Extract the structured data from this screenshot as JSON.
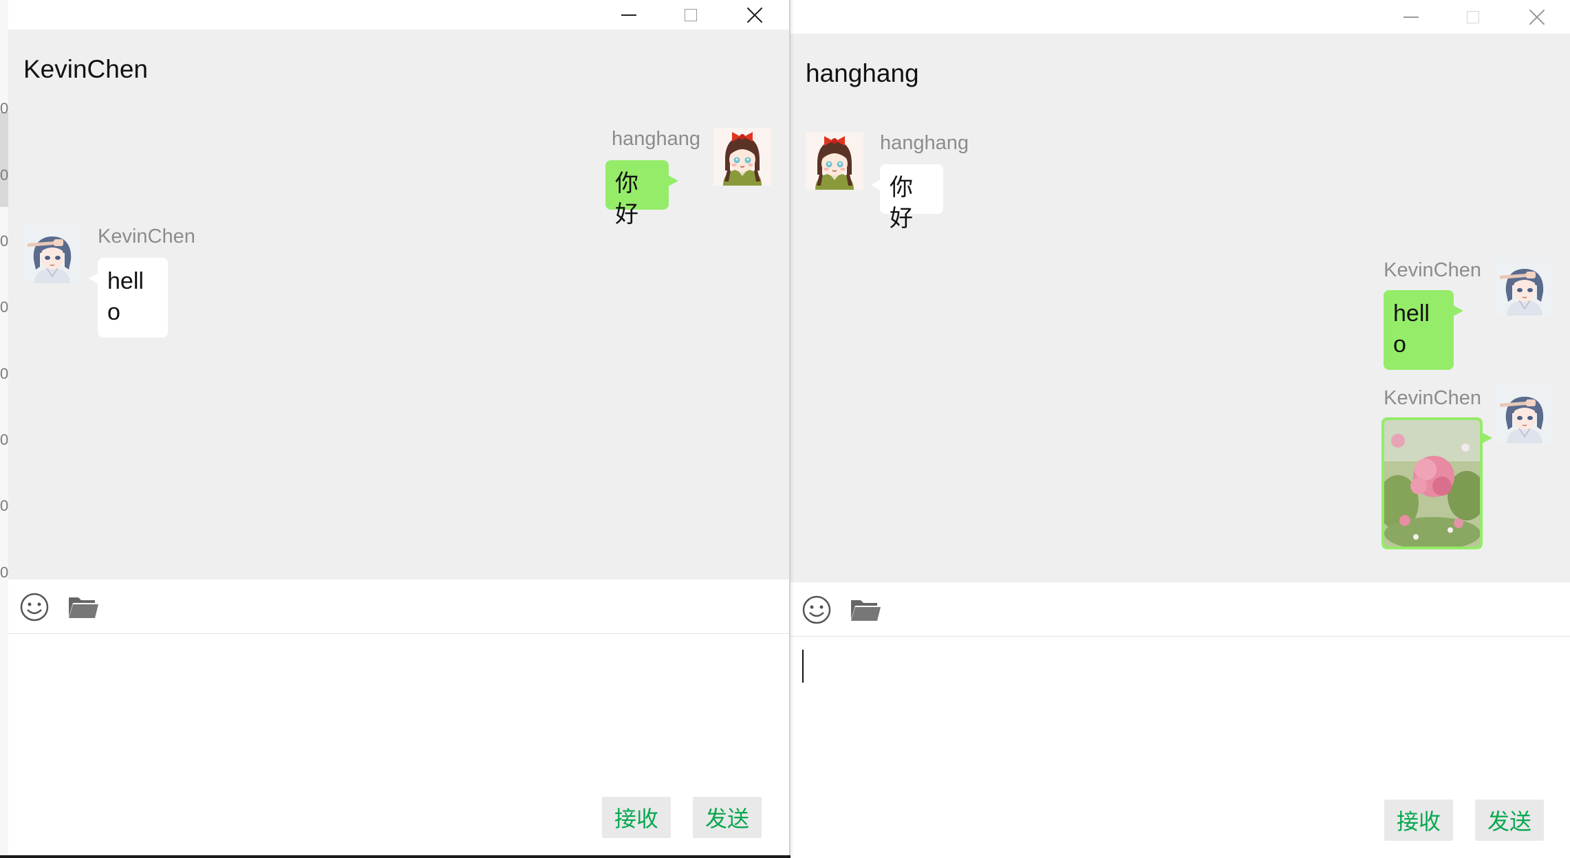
{
  "background": {
    "left_margin_digits": [
      "0",
      "0",
      "0",
      "0",
      "0",
      "0",
      "0",
      "0"
    ]
  },
  "left_window": {
    "title": "KevinChen",
    "messages": [
      {
        "sender": "hanghang",
        "side": "right",
        "text": "你好"
      },
      {
        "sender": "KevinChen",
        "side": "left",
        "text": "hell\no"
      }
    ],
    "buttons": {
      "receive": "接收",
      "send": "发送"
    }
  },
  "right_window": {
    "title": "hanghang",
    "messages": [
      {
        "sender": "hanghang",
        "side": "left",
        "text": "你好"
      },
      {
        "sender": "KevinChen",
        "side": "right",
        "text": "hell\no"
      },
      {
        "sender": "KevinChen",
        "side": "right",
        "image": "flower-photo"
      }
    ],
    "buttons": {
      "receive": "接收",
      "send": "发送"
    }
  },
  "icons": {
    "minimize": "minimize-icon",
    "maximize": "maximize-icon",
    "close": "close-icon",
    "emoji": "emoji-icon",
    "folder": "folder-icon",
    "avatar_hanghang": "girl-avatar-red-bow",
    "avatar_kevinchen": "girl-avatar-blue-hair"
  },
  "colors": {
    "chat_bg": "#efefef",
    "bubble_green": "#95ec69",
    "bubble_white": "#ffffff",
    "button_text": "#07a84f",
    "button_bg": "#e9e9e9",
    "nickname": "#8c8c8c"
  }
}
